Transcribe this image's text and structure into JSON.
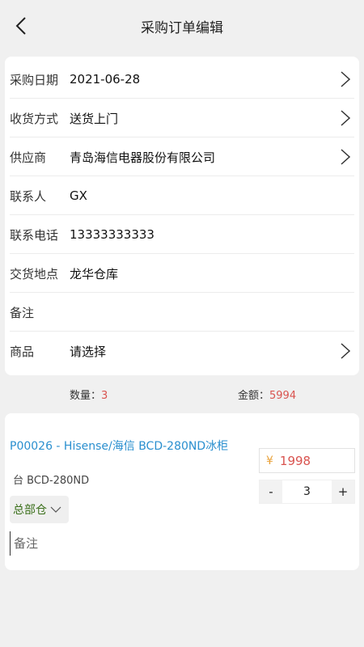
{
  "header": {
    "title": "采购订单编辑",
    "back_icon": "back-chevron-icon"
  },
  "form": {
    "rows": [
      {
        "label": "采购日期",
        "value": "2021-06-28",
        "has_arrow": true
      },
      {
        "label": "收货方式",
        "value": "送货上门",
        "has_arrow": true
      },
      {
        "label": "供应商",
        "value": "青岛海信电器股份有限公司",
        "has_arrow": true
      },
      {
        "label": "联系人",
        "value": "GX",
        "has_arrow": false
      },
      {
        "label": "联系电话",
        "value": "13333333333",
        "has_arrow": false
      },
      {
        "label": "交货地点",
        "value": "龙华仓库",
        "has_arrow": false
      },
      {
        "label": "备注",
        "value": "",
        "has_arrow": false
      },
      {
        "label": "商品",
        "value": "请选择",
        "has_arrow": true
      }
    ]
  },
  "summary": {
    "qty_label": "数量：",
    "qty_value": "3",
    "amount_label": "金额：",
    "amount_value": "5994"
  },
  "item": {
    "title": "P00026 - Hisense/海信 BCD-280ND冰柜",
    "spec": "台 BCD-280ND",
    "currency": "¥",
    "price": "1998",
    "minus": "-",
    "quantity": "3",
    "plus": "+",
    "warehouse": "总部仓",
    "remark_placeholder": "备注"
  },
  "colors": {
    "accent_blue": "#2a8fcf",
    "price_red": "#d9534f",
    "yen_orange": "#e9a23b",
    "warehouse_green": "#3a6f1a"
  }
}
